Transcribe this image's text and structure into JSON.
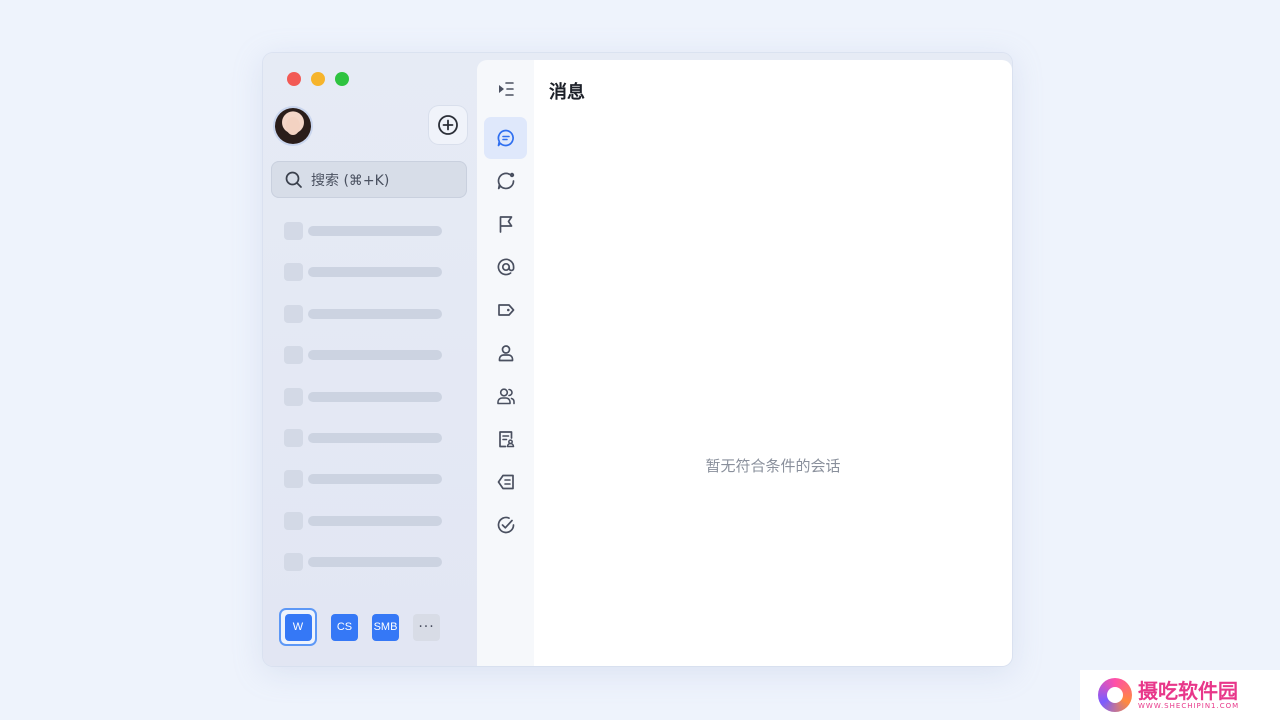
{
  "sidebar": {
    "search_placeholder": "搜索 (⌘+K)",
    "skeleton_rows": 9,
    "workspaces": [
      {
        "label": "W",
        "active": true
      },
      {
        "label": "CS",
        "active": false
      },
      {
        "label": "SMB",
        "active": false
      }
    ],
    "more_label": "···"
  },
  "rail": {
    "items": [
      {
        "icon": "collapse-sidebar-icon",
        "active": false
      },
      {
        "icon": "message-icon",
        "active": true
      },
      {
        "icon": "unread-chat-icon",
        "active": false
      },
      {
        "icon": "flag-icon",
        "active": false
      },
      {
        "icon": "at-mention-icon",
        "active": false
      },
      {
        "icon": "tag-icon",
        "active": false
      },
      {
        "icon": "single-chat-icon",
        "active": false
      },
      {
        "icon": "group-chat-icon",
        "active": false
      },
      {
        "icon": "doc-icon",
        "active": false
      },
      {
        "icon": "done-icon",
        "active": false
      },
      {
        "icon": "task-check-icon",
        "active": false
      }
    ]
  },
  "main": {
    "title": "消息",
    "empty_text": "暂无符合条件的会话"
  },
  "watermark": {
    "cn": "摄吃软件园",
    "en": "WWW.SHECHIPIN1.COM"
  },
  "colors": {
    "accent": "#3578f6",
    "active_rail_bg": "#dfe8fb",
    "active_icon": "#2f6ff0"
  }
}
